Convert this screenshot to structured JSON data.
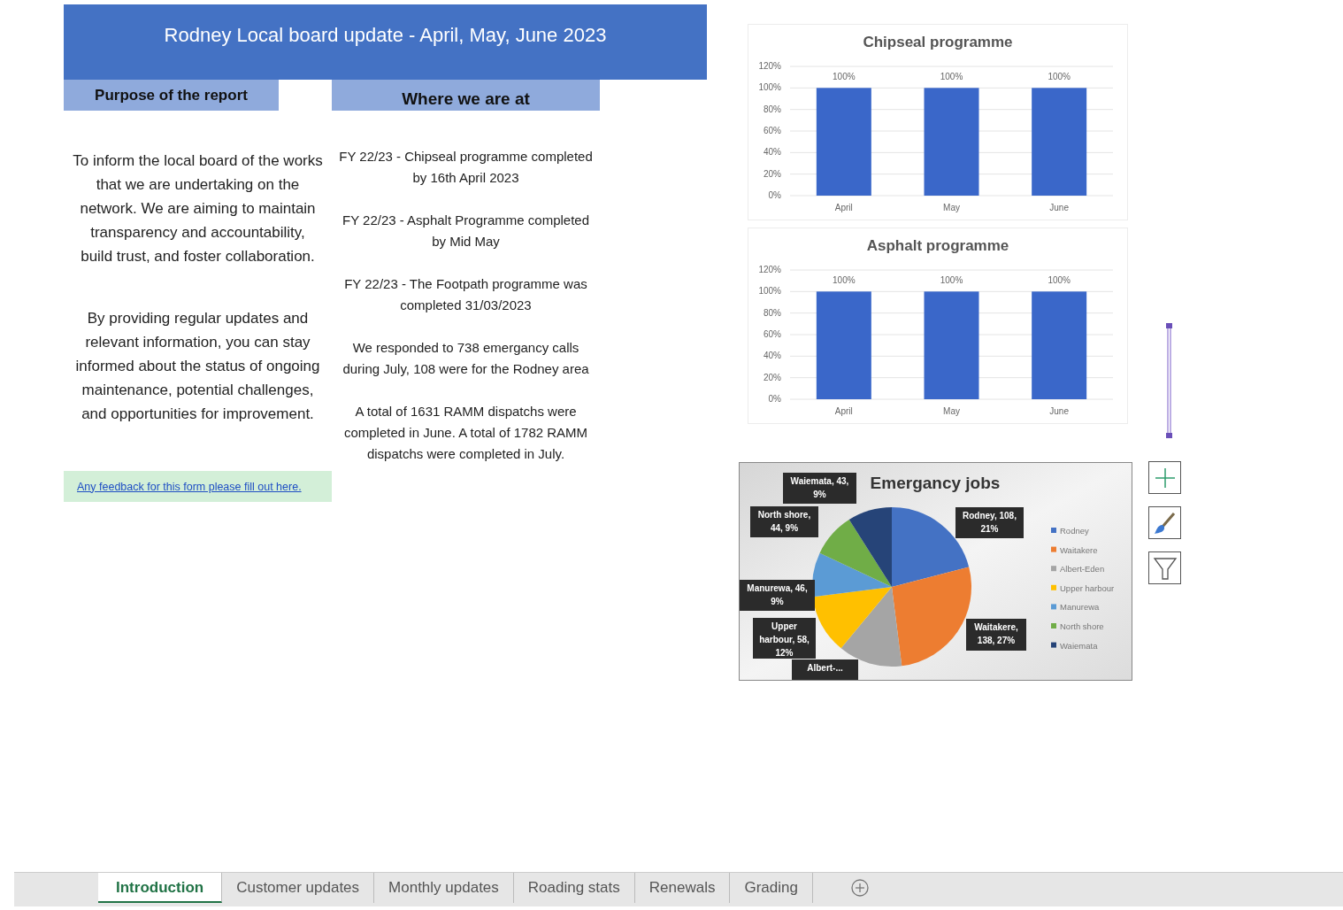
{
  "header": {
    "title": "Rodney Local board update - April, May, June 2023"
  },
  "section_tags": [
    "Purpose of the report",
    "Where we are at"
  ],
  "purpose_paragraphs": [
    "To inform the local board of the works that we are undertaking on the network.  We are aiming to maintain transparency and accountability, build trust, and foster collaboration.",
    "By providing regular updates and relevant information, you can stay informed about the status of ongoing maintenance, potential challenges, and opportunities for improvement."
  ],
  "status_paragraphs": [
    "FY 22/23 - Chipseal programme completed by 16th April 2023",
    "FY 22/23 - Asphalt Programme completed by Mid May",
    "FY 22/23 - The Footpath programme was completed 31/03/2023",
    "We responded to 738 emergancy calls during July, 108 were for the Rodney area",
    "A total of 1631 RAMM dispatchs were completed in June. A total of 1782 RAMM dispatchs were completed in July."
  ],
  "feedback_link": "Any feedback for this form please fill out here.",
  "bar_charts": [
    {
      "chart_data": {
        "type": "bar",
        "grid": true,
        "title": "Chipseal programme",
        "categories": [
          "April",
          "May",
          "June"
        ],
        "values": [
          100,
          100,
          100
        ],
        "value_labels": [
          "100%",
          "100%",
          "100%"
        ],
        "ylim": [
          0,
          120
        ],
        "yticks": [
          {
            "value": 0,
            "label": "0%"
          },
          {
            "value": 20,
            "label": "20%"
          },
          {
            "value": 40,
            "label": "40%"
          },
          {
            "value": 60,
            "label": "60%"
          },
          {
            "value": 80,
            "label": "80%"
          },
          {
            "value": 100,
            "label": "100%"
          },
          {
            "value": 120,
            "label": "120%"
          }
        ]
      }
    },
    {
      "chart_data": {
        "type": "bar",
        "grid": true,
        "title": "Asphalt programme",
        "categories": [
          "April",
          "May",
          "June"
        ],
        "values": [
          100,
          100,
          100
        ],
        "value_labels": [
          "100%",
          "100%",
          "100%"
        ],
        "ylim": [
          0,
          120
        ],
        "yticks": [
          {
            "value": 0,
            "label": "0%"
          },
          {
            "value": 20,
            "label": "20%"
          },
          {
            "value": 40,
            "label": "40%"
          },
          {
            "value": 60,
            "label": "60%"
          },
          {
            "value": 80,
            "label": "80%"
          },
          {
            "value": 100,
            "label": "100%"
          },
          {
            "value": 120,
            "label": "120%"
          }
        ]
      }
    }
  ],
  "pie_chart": {
    "chart_data": {
      "type": "pie",
      "title": "Emergancy jobs",
      "categories": [
        "Rodney",
        "Waitakere",
        "Albert-Eden",
        "Upper harbour",
        "Manurewa",
        "North shore",
        "Waiemata"
      ],
      "values": [
        21,
        27,
        13,
        12,
        9,
        9,
        9
      ],
      "legend": true
    },
    "data_labels": [
      {
        "lines": [
          "Waiemata, 43,",
          "9%"
        ]
      },
      {
        "lines": [
          "North shore,",
          "44, 9%"
        ]
      },
      {
        "lines": [
          "Rodney, 108,",
          "21%"
        ]
      },
      {
        "lines": [
          "Manurewa, 46,",
          "9%"
        ]
      },
      {
        "lines": [
          "Upper",
          "harbour, 58,",
          "12%"
        ]
      },
      {
        "lines": [
          "Waitakere,",
          "138, 27%"
        ]
      },
      {
        "lines": [
          "Albert-..."
        ]
      }
    ]
  },
  "tabs": [
    {
      "label": "Introduction",
      "selected": true
    },
    {
      "label": "Customer updates",
      "selected": false
    },
    {
      "label": "Monthly updates",
      "selected": false
    },
    {
      "label": "Roading stats",
      "selected": false
    },
    {
      "label": "Renewals",
      "selected": false
    },
    {
      "label": "Grading",
      "selected": false
    }
  ]
}
